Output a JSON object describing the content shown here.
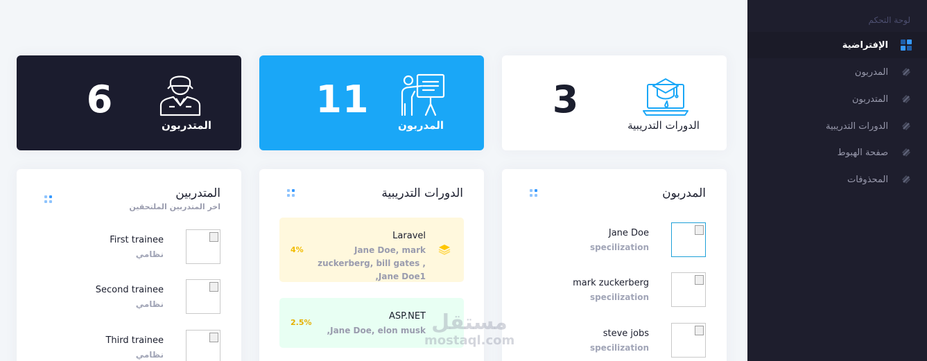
{
  "sidebar": {
    "section_title": "لوحة التحكم",
    "items": [
      {
        "label": "الإفتراضية",
        "icon": "dashboard-grid-icon",
        "active": true
      },
      {
        "label": "المدربون",
        "icon": "layers-icon"
      },
      {
        "label": "المتدربون",
        "icon": "layers-icon"
      },
      {
        "label": "الدورات التدريبية",
        "icon": "layers-icon"
      },
      {
        "label": "صفحة الهبوط",
        "icon": "layers-icon"
      },
      {
        "label": "المحذوفات",
        "icon": "layers-icon"
      }
    ]
  },
  "stats": {
    "courses": {
      "value": "3",
      "label": "الدورات التدريبية",
      "icon": "laptop-graduation-icon"
    },
    "trainers": {
      "value": "11",
      "label": "المدربون",
      "icon": "presenter-board-icon"
    },
    "trainees": {
      "value": "6",
      "label": "المتدربون",
      "icon": "student-icon"
    }
  },
  "colors": {
    "primary": "#3699ff",
    "dark": "#1b1e2e",
    "sidebar": "#1e1e2d",
    "warning": "#ffc700",
    "success": "#50cd89"
  },
  "trainers_card": {
    "title": "المدربون",
    "items": [
      {
        "name": "Jane Doe",
        "specialization": "specilization"
      },
      {
        "name": "mark zuckerberg",
        "specialization": "specilization"
      },
      {
        "name": "steve jobs",
        "specialization": "specilization"
      }
    ]
  },
  "courses_card": {
    "title": "الدورات التدريبية",
    "items": [
      {
        "title": "Laravel",
        "trainers": "Jane Doe, mark zuckerberg, bill gates , Jane Doe1,",
        "percent": "4%"
      },
      {
        "title": "ASP.NET",
        "trainers": "Jane Doe, elon musk,",
        "percent": "2.5%"
      }
    ]
  },
  "trainees_card": {
    "title": "المتدربين",
    "subtitle": "اخر المتدربين الملتحقين",
    "items": [
      {
        "name": "First trainee",
        "type": "نظامي"
      },
      {
        "name": "Second trainee",
        "type": "نظامي"
      },
      {
        "name": "Third trainee",
        "type": "نظامي"
      }
    ]
  },
  "watermark": {
    "arabic": "مستقل",
    "latin": "mostaql.com"
  }
}
